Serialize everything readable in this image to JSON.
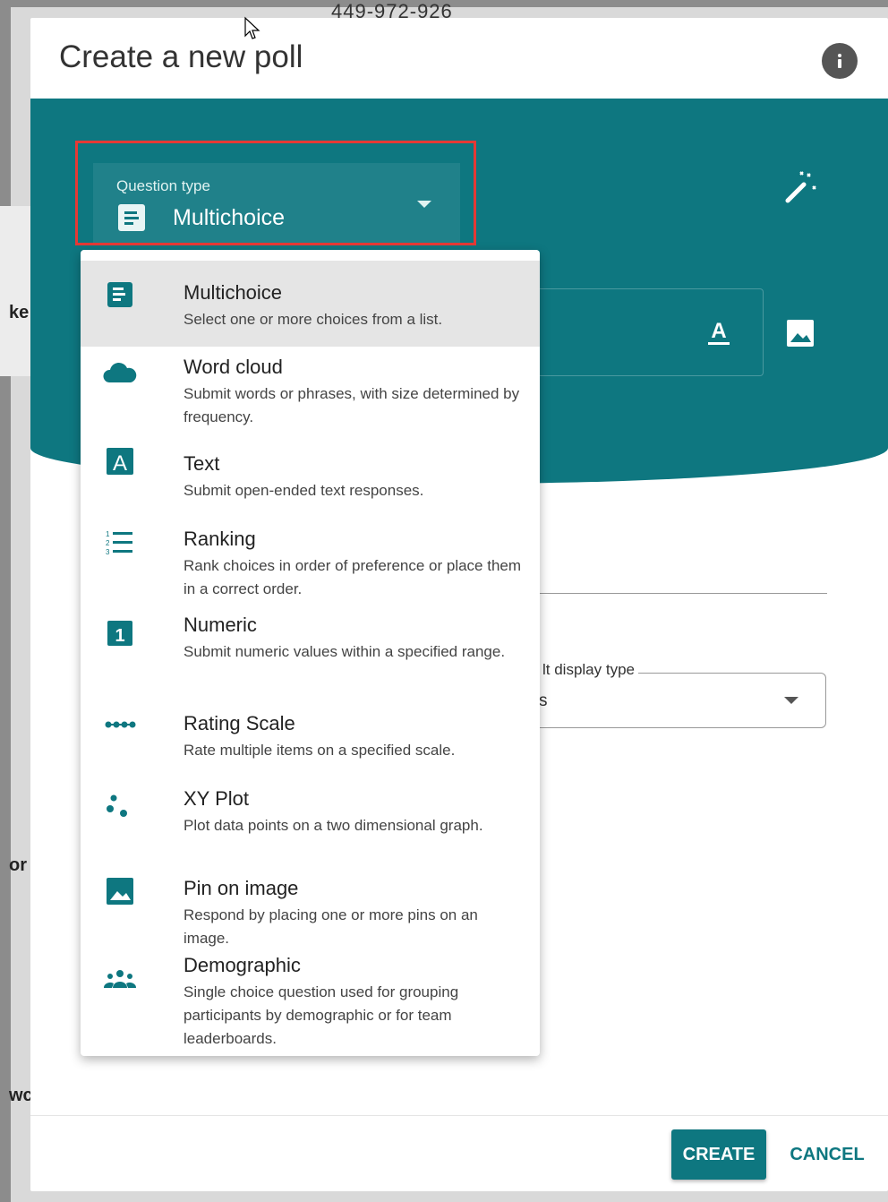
{
  "background": {
    "phone_fragment": "449-972-926",
    "side_fragments": [
      "ke",
      "or",
      "wc"
    ]
  },
  "dialog": {
    "title": "Create a new poll",
    "question_type": {
      "label": "Question type",
      "value": "Multichoice"
    },
    "display_type": {
      "label": "lt display type",
      "value": "s"
    },
    "buttons": {
      "create": "CREATE",
      "cancel": "CANCEL"
    }
  },
  "menu": {
    "items": [
      {
        "title": "Multichoice",
        "desc": "Select one or more choices from a list.",
        "icon": "multichoice-icon",
        "selected": true
      },
      {
        "title": "Word cloud",
        "desc": "Submit words or phrases, with size determined by frequency.",
        "icon": "cloud-icon"
      },
      {
        "title": "Text",
        "desc": "Submit open-ended text responses.",
        "icon": "text-icon"
      },
      {
        "title": "Ranking",
        "desc": "Rank choices in order of preference or place them in a correct order.",
        "icon": "ranking-icon"
      },
      {
        "title": "Numeric",
        "desc": "Submit numeric values within a specified range.",
        "icon": "numeric-icon"
      },
      {
        "title": "Rating Scale",
        "desc": "Rate multiple items on a specified scale.",
        "icon": "rating-scale-icon"
      },
      {
        "title": "XY Plot",
        "desc": "Plot data points on a two dimensional graph.",
        "icon": "xy-plot-icon"
      },
      {
        "title": "Pin on image",
        "desc": "Respond by placing one or more pins on an image.",
        "icon": "image-icon"
      },
      {
        "title": "Demographic",
        "desc": "Single choice question used for grouping participants by demographic or for team leaderboards.",
        "icon": "group-icon"
      }
    ]
  },
  "colors": {
    "teal": "#0e7780",
    "highlight": "#e53935"
  }
}
